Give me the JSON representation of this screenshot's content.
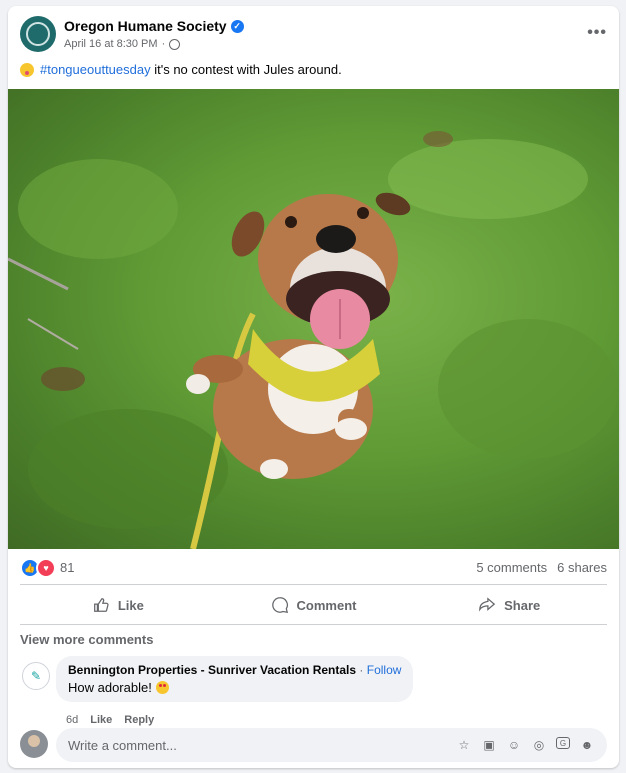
{
  "post": {
    "page_name": "Oregon Humane Society",
    "timestamp": "April 16 at 8:30 PM",
    "meta_separator": "·",
    "more_label": "•••",
    "hashtag": "#tongueouttuesday",
    "caption_rest": " it's no contest with Jules around."
  },
  "stats": {
    "reactions_count": "81",
    "comments": "5 comments",
    "shares": "6 shares"
  },
  "actions": {
    "like": "Like",
    "comment": "Comment",
    "share": "Share"
  },
  "comments": {
    "view_more": "View more comments",
    "items": [
      {
        "author": "Bennington Properties - Sunriver Vacation Rentals",
        "follow_sep": " · ",
        "follow": "Follow",
        "text": "How adorable!",
        "age": "6d",
        "like": "Like",
        "reply": "Reply"
      }
    ]
  },
  "composer": {
    "placeholder": "Write a comment..."
  },
  "colors": {
    "accent": "#1877f2",
    "link": "#216fdb",
    "love": "#f33e58"
  }
}
